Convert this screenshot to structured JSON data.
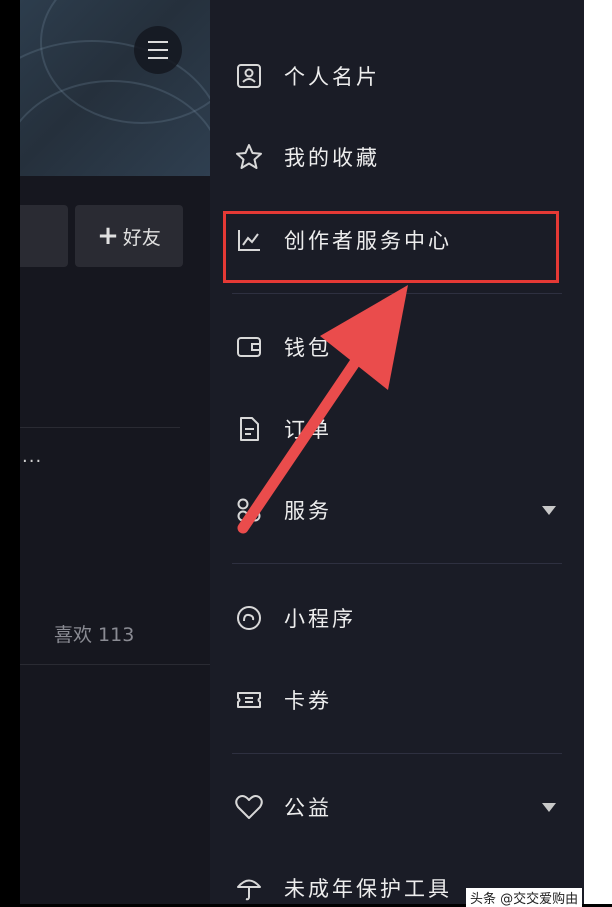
{
  "background_profile": {
    "add_friend_label": "好友",
    "more_dots": "...",
    "likes_text": "喜欢 113"
  },
  "drawer": {
    "items": [
      {
        "label": "个人名片",
        "icon": "id-card-icon"
      },
      {
        "label": "我的收藏",
        "icon": "star-icon"
      },
      {
        "label": "创作者服务中心",
        "icon": "chart-line-icon"
      },
      {
        "label": "钱包",
        "icon": "wallet-icon"
      },
      {
        "label": "订单",
        "icon": "document-icon"
      },
      {
        "label": "服务",
        "icon": "services-icon"
      },
      {
        "label": "小程序",
        "icon": "mini-program-icon"
      },
      {
        "label": "卡券",
        "icon": "ticket-icon"
      },
      {
        "label": "公益",
        "icon": "heart-icon"
      },
      {
        "label": "未成年保护工具",
        "icon": "umbrella-icon"
      }
    ]
  },
  "annotation": {
    "highlight_color": "#e53935"
  },
  "watermark": "头条 @交交爱购由"
}
